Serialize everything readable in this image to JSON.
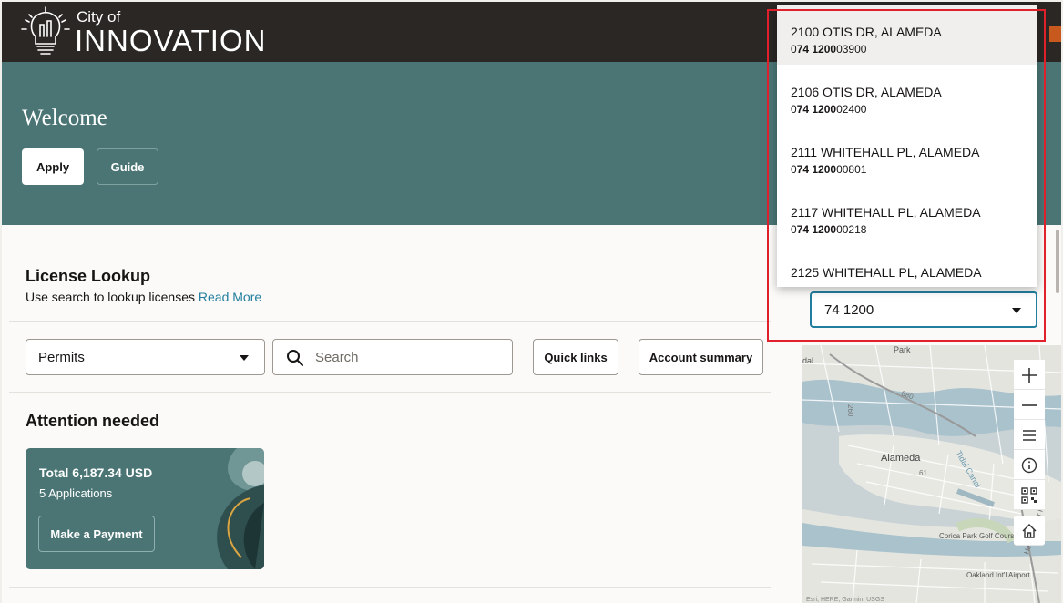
{
  "header": {
    "brand_small": "City of",
    "brand_big": "INNOVATION",
    "logo_icon": "lightbulb-logo-icon"
  },
  "hero": {
    "title": "Welcome",
    "apply_label": "Apply",
    "guide_label": "Guide"
  },
  "license_lookup": {
    "title": "License Lookup",
    "subtitle": "Use search to lookup licenses",
    "read_more": "Read More",
    "category_value": "Permits",
    "search_placeholder": "Search",
    "quick_links_label": "Quick links",
    "account_summary_label": "Account summary"
  },
  "attention": {
    "title": "Attention needed",
    "card": {
      "total": "Total 6,187.34 USD",
      "applications": "5 Applications",
      "button": "Make a Payment"
    }
  },
  "address_search": {
    "value": "74 1200",
    "options": [
      {
        "address": "2100 OTIS DR, ALAMEDA",
        "parcel_pre": "0",
        "parcel_bold": "74 1200",
        "parcel_post": "03900"
      },
      {
        "address": "2106 OTIS DR, ALAMEDA",
        "parcel_pre": "0",
        "parcel_bold": "74 1200",
        "parcel_post": "02400"
      },
      {
        "address": "2111 WHITEHALL PL, ALAMEDA",
        "parcel_pre": "0",
        "parcel_bold": "74 1200",
        "parcel_post": "00801"
      },
      {
        "address": "2117 WHITEHALL PL, ALAMEDA",
        "parcel_pre": "0",
        "parcel_bold": "74 1200",
        "parcel_post": "00218"
      },
      {
        "address": "2125 WHITEHALL PL, ALAMEDA"
      }
    ]
  },
  "map": {
    "labels": {
      "city": "Alameda",
      "park": "Park",
      "dal": "dal",
      "golf": "Corica Park Golf Course",
      "airport": "Oakland Int'l Airport",
      "canal": "Tidal Canal",
      "highway_880": "880",
      "road_61": "61",
      "road_260": "260",
      "hegenberger": "Hegenberger Rd",
      "attribution": "Esri, HERE, Garmin, USGS"
    },
    "tools": [
      "zoom-in-icon",
      "zoom-out-icon",
      "layers-list-icon",
      "info-icon",
      "qr-code-icon",
      "home-icon"
    ]
  },
  "colors": {
    "header_bg": "#2a2724",
    "hero_bg": "#4a7574",
    "accent": "#227e9e",
    "highlight": "#e0212c"
  }
}
